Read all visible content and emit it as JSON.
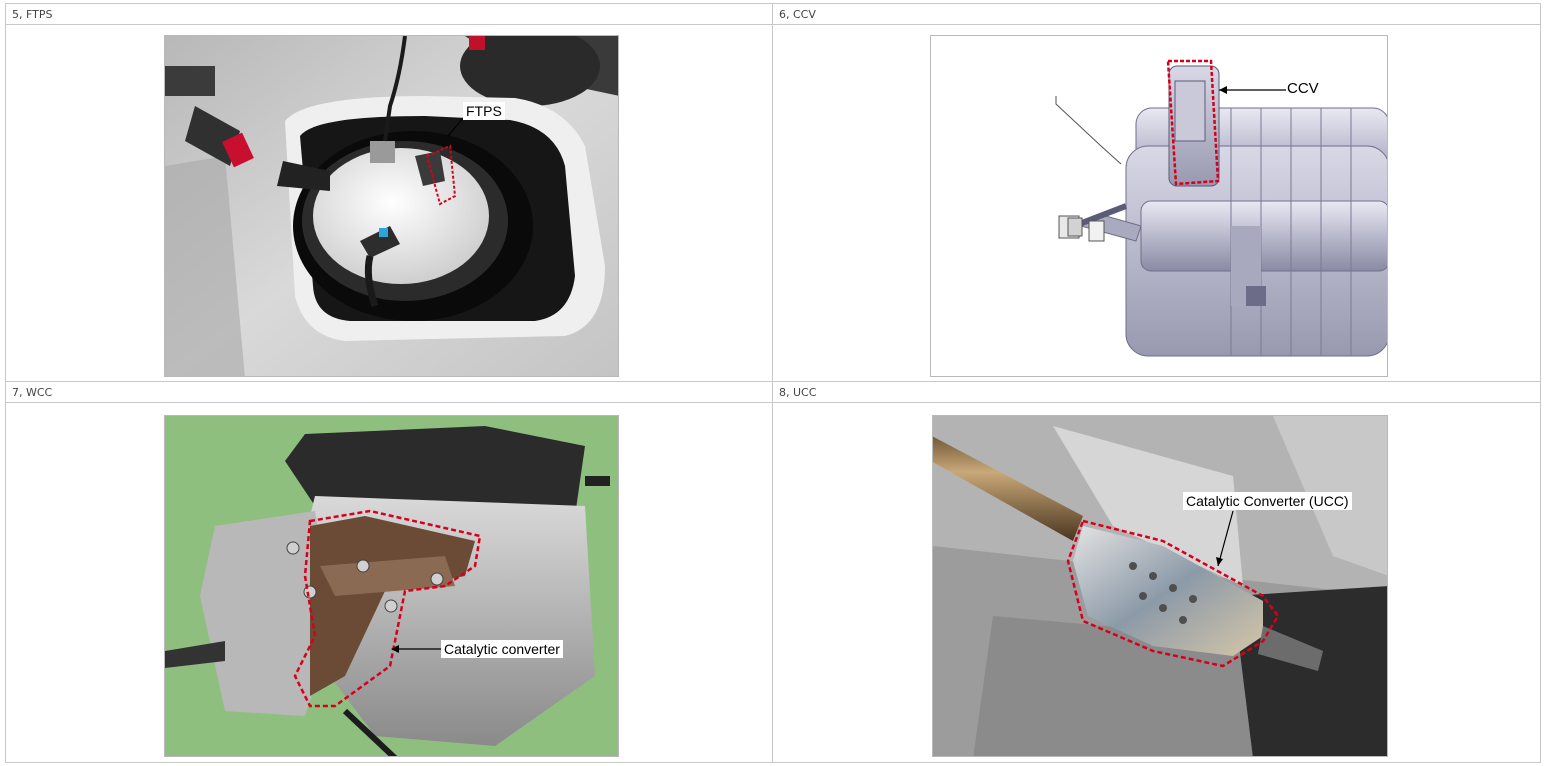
{
  "cells": [
    {
      "header": "5, FTPS",
      "callout": "FTPS",
      "subject": "fuel-tank-pressure-sensor-photo"
    },
    {
      "header": "6, CCV",
      "callout": "CCV",
      "subject": "canister-close-valve-drawing"
    },
    {
      "header": "7, WCC",
      "callout": "Catalytic converter",
      "subject": "engine-warm-up-catalytic-converter-photo"
    },
    {
      "header": "8, UCC",
      "callout": "Catalytic Converter  (UCC)",
      "subject": "underfloor-catalytic-converter-photo"
    }
  ],
  "colors": {
    "grid_border": "#c8c8c8",
    "header_text": "#444444",
    "highlight_outline": "#d6001c",
    "wcc_background": "#8fbf7f"
  }
}
